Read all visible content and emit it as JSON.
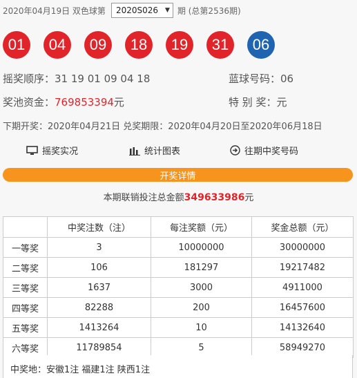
{
  "header": {
    "date": "2020年04月19日",
    "game": "双色球第",
    "issue_selected": "2020S026",
    "suffix": "期 (总第2536期)"
  },
  "balls": {
    "red": [
      "01",
      "04",
      "09",
      "18",
      "19",
      "31"
    ],
    "blue": [
      "06"
    ],
    "colors": {
      "red": "#e1242a",
      "blue": "#1f64b0"
    }
  },
  "info": {
    "order_label": "摇奖顺序：",
    "order_value": "31 19 01 09 04 18",
    "blue_label": "蓝球号码：",
    "blue_value": "06",
    "pool_label": "奖池资金：",
    "pool_value": "769853394",
    "pool_unit": "元",
    "special_label": "特 别 奖：",
    "special_value": "元",
    "next_draw": "下期开奖：2020年04月21日 兑奖期限：2020年04月20日至2020年06月18日"
  },
  "links": {
    "live": "摇奖实况",
    "chart": "统计图表",
    "history": "往期中奖号码"
  },
  "details_button": "开奖详情",
  "sales": {
    "label": "本期联销投注总金额",
    "amount": "349633986",
    "unit": "元"
  },
  "table": {
    "headers": [
      "",
      "中奖注数（注）",
      "每注奖额（元）",
      "奖金总额（元）"
    ],
    "rows": [
      [
        "一等奖",
        "3",
        "10000000",
        "30000000"
      ],
      [
        "二等奖",
        "106",
        "181297",
        "19217482"
      ],
      [
        "三等奖",
        "1637",
        "3000",
        "4911000"
      ],
      [
        "四等奖",
        "82288",
        "200",
        "16457600"
      ],
      [
        "五等奖",
        "1413264",
        "10",
        "14132640"
      ],
      [
        "六等奖",
        "11789854",
        "5",
        "58949270"
      ]
    ]
  },
  "winning_locations": "中奖地：安徽1注 福建1注 陕西1注"
}
